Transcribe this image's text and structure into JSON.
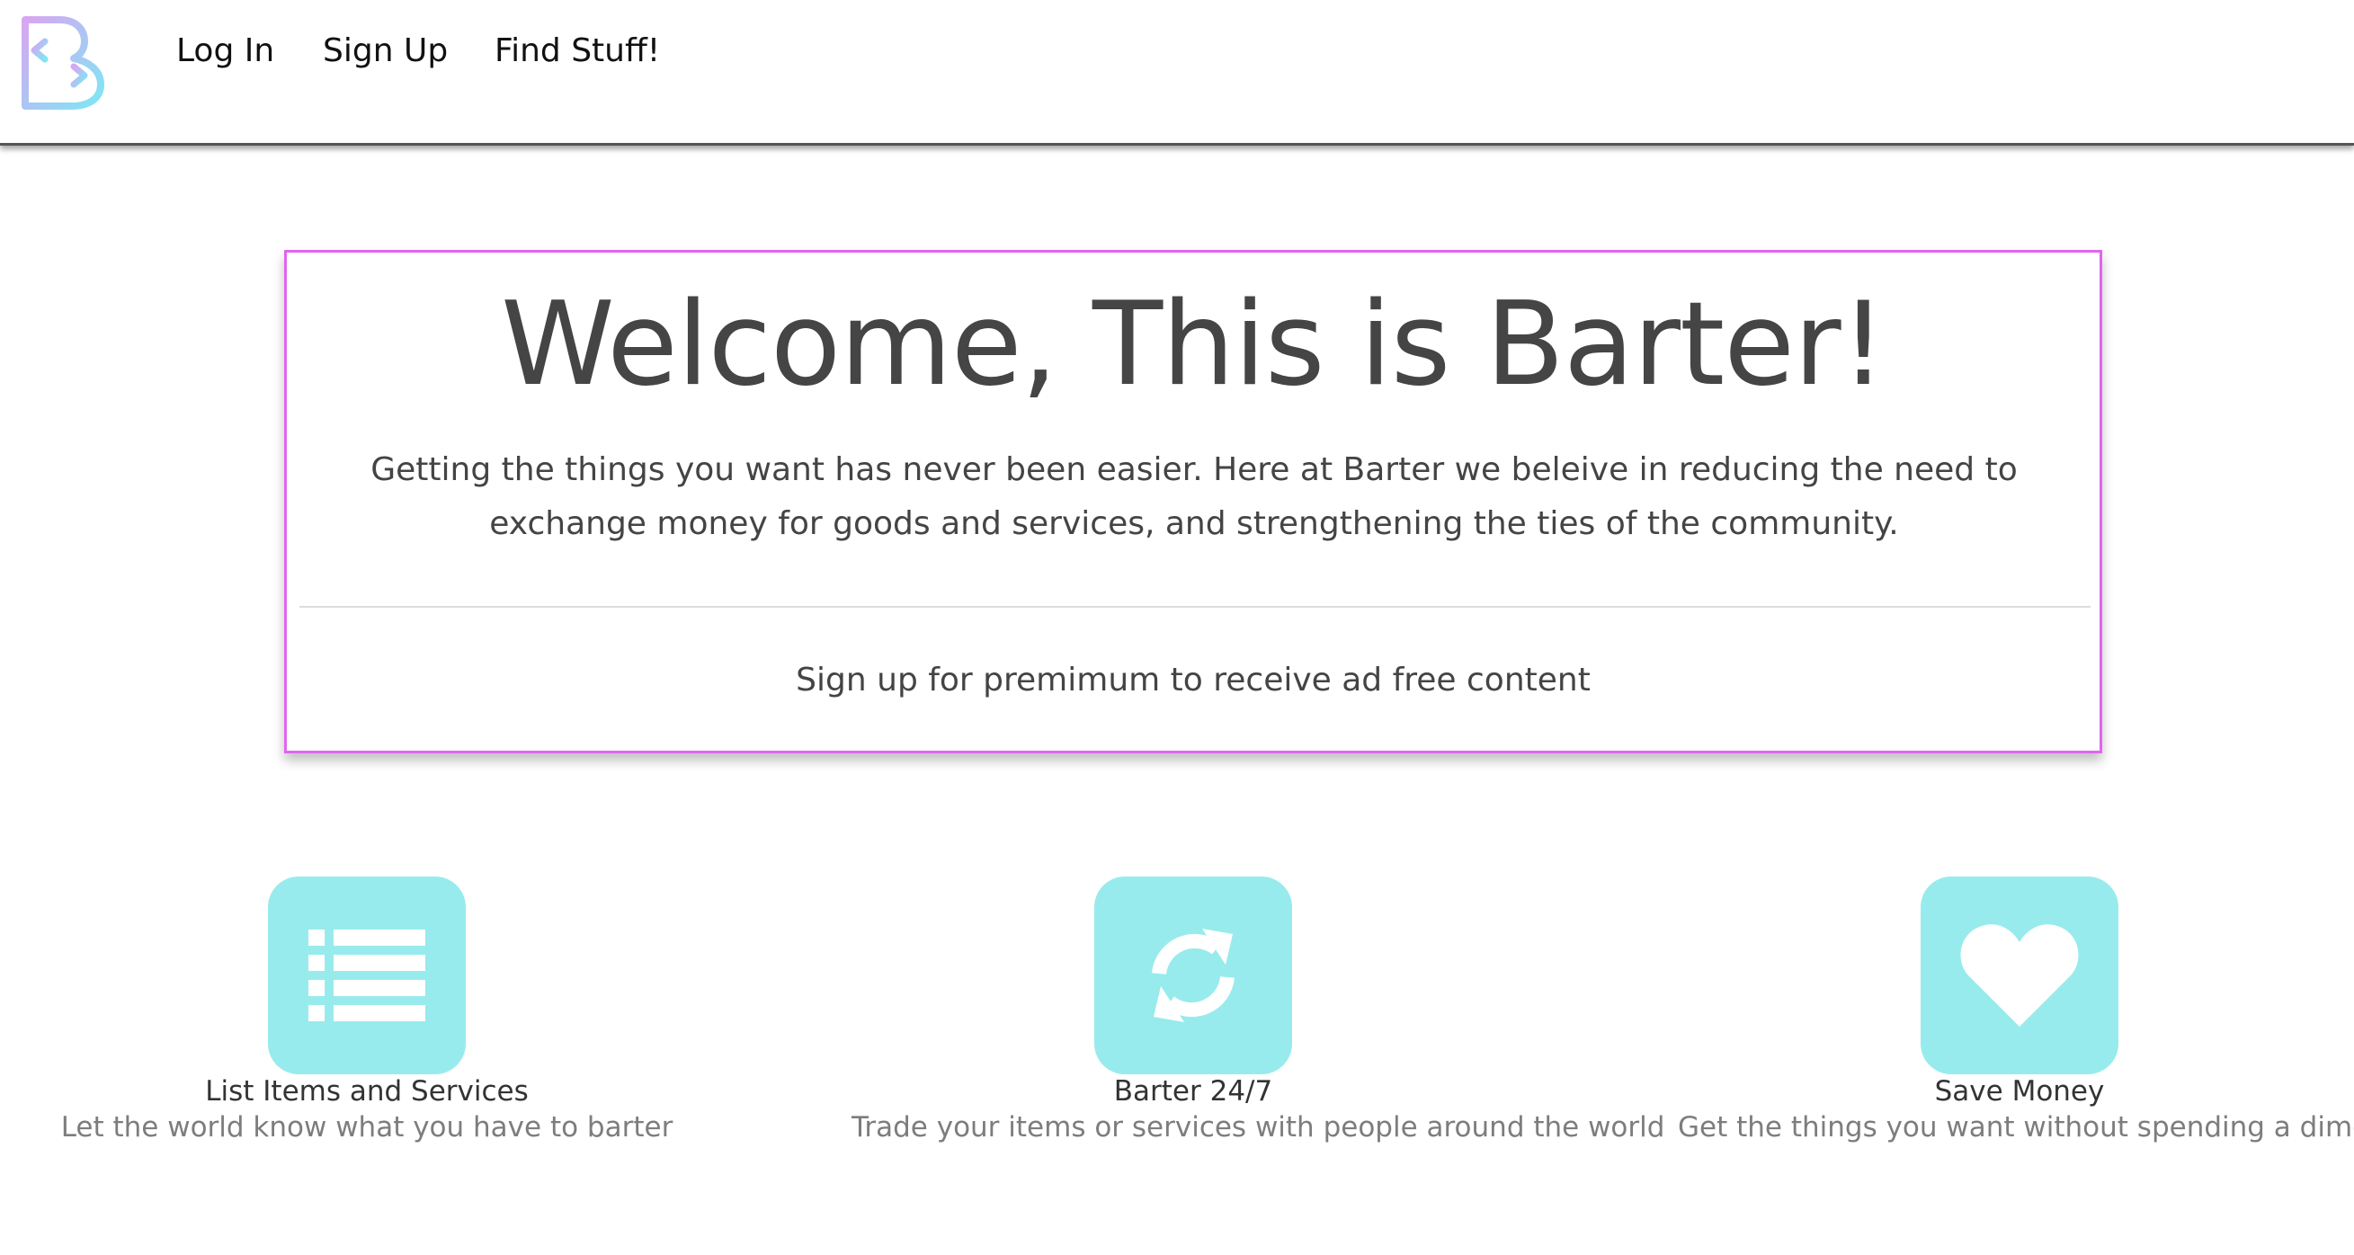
{
  "brand": {
    "logo_icon": "barter-logo-icon",
    "gradient_start": "#d8a6f2",
    "gradient_end": "#7fe6f5"
  },
  "nav": {
    "items": [
      {
        "label": "Log In"
      },
      {
        "label": "Sign Up"
      },
      {
        "label": "Find Stuff!"
      }
    ]
  },
  "hero": {
    "title": "Welcome, This is Barter!",
    "description": "Getting the things you want has never been easier. Here at Barter we beleive in reducing the need to exchange money for goods and services, and strengthening the ties of the community.",
    "premium_text": "Sign up for premimum to receive ad free content",
    "border_color": "#e066ee"
  },
  "features": [
    {
      "icon": "list-icon",
      "title": "List Items and Services",
      "description": "Let the world know what you have to barter"
    },
    {
      "icon": "refresh-icon",
      "title": "Barter 24/7",
      "description": "Trade your items or services with people around the world"
    },
    {
      "icon": "heart-icon",
      "title": "Save Money",
      "description": "Get the things you want without spending a dime"
    }
  ],
  "colors": {
    "icon_tile": "#98ebec",
    "text_dark": "#454545",
    "text_muted": "#7d7d7d"
  }
}
